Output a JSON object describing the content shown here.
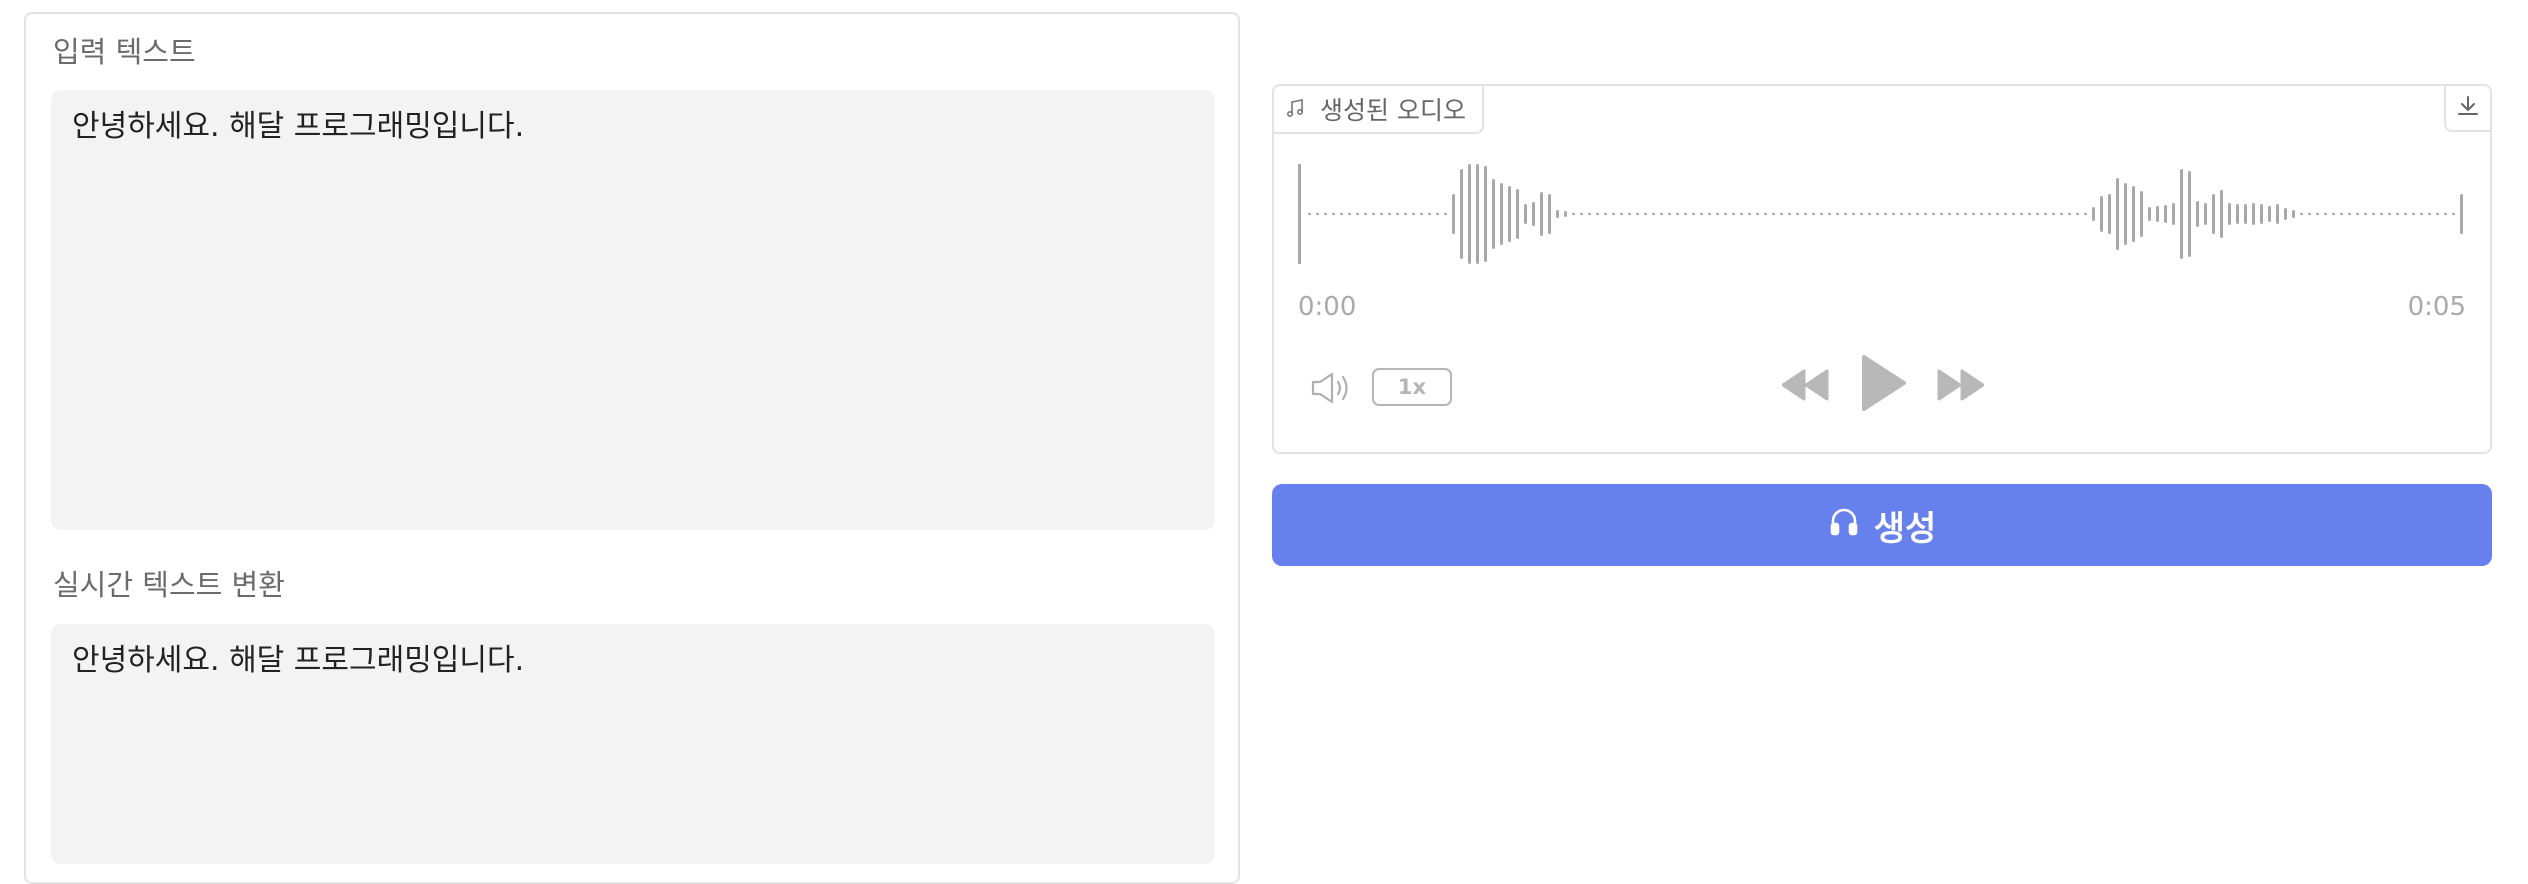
{
  "input_section": {
    "label": "입력 텍스트",
    "value": "안녕하세요. 해달 프로그래밍입니다."
  },
  "realtime_section": {
    "label": "실시간 텍스트 변환",
    "value": "안녕하세요. 해달 프로그래밍입니다."
  },
  "audio_player": {
    "tab_label": "생성된 오디오",
    "current_time": "0:00",
    "duration": "0:05",
    "playback_speed": "1x",
    "icons": {
      "tab": "music-note-icon",
      "download": "download-icon",
      "volume": "volume-icon",
      "rewind": "rewind-icon",
      "play": "play-icon",
      "forward": "fast-forward-icon"
    }
  },
  "generate_button": {
    "label": "생성",
    "icon": "headphones-icon"
  },
  "colors": {
    "accent": "#6681ee",
    "textbox_bg": "#f3f3f3",
    "border": "#e3e3e3",
    "waveform": "#a6a8ae",
    "control_icon": "#b8b8b8"
  }
}
